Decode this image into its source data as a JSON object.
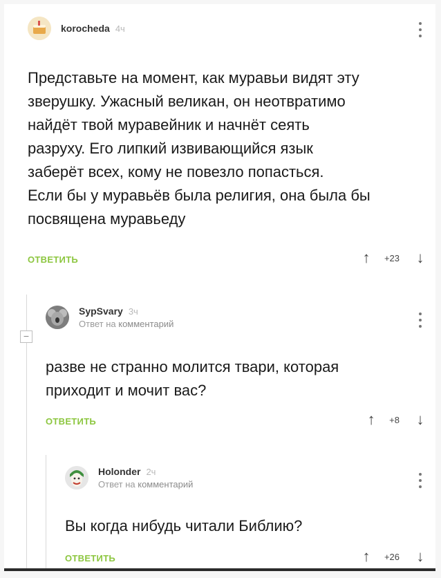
{
  "comments": [
    {
      "author": "korocheda",
      "time": "4ч",
      "lines": [
        "Представьте на момент, как муравьи видят эту",
        "зверушку. Ужасный великан, он неотвратимо",
        "найдёт твой муравейник и начнёт сеять",
        "разруху. Его липкий извивающийся язык",
        "заберёт всех, кому не повезло попасться.",
        "Если бы у муравьёв была религия, она была бы",
        "посвящена муравьеду"
      ],
      "reply_label": "ОТВЕТИТЬ",
      "up_icon": "↑",
      "votes": "+23",
      "down_icon": "↓"
    },
    {
      "author": "SypSvary",
      "time": "3ч",
      "reply_to_prefix": "Ответ на",
      "reply_to_link": "комментарий",
      "lines": [
        "разве не странно молится твари, которая",
        "приходит и мочит вас?"
      ],
      "reply_label": "ОТВЕТИТЬ",
      "up_icon": "↑",
      "votes": "+8",
      "down_icon": "↓"
    },
    {
      "author": "Holonder",
      "time": "2ч",
      "reply_to_prefix": "Ответ на",
      "reply_to_link": "комментарий",
      "lines": [
        "Вы когда нибудь читали Библию?"
      ],
      "reply_label": "ОТВЕТИТЬ",
      "up_icon": "↑",
      "votes": "+26",
      "down_icon": "↓"
    }
  ],
  "collapse_symbol": "−",
  "accent_color": "#8cc63f"
}
